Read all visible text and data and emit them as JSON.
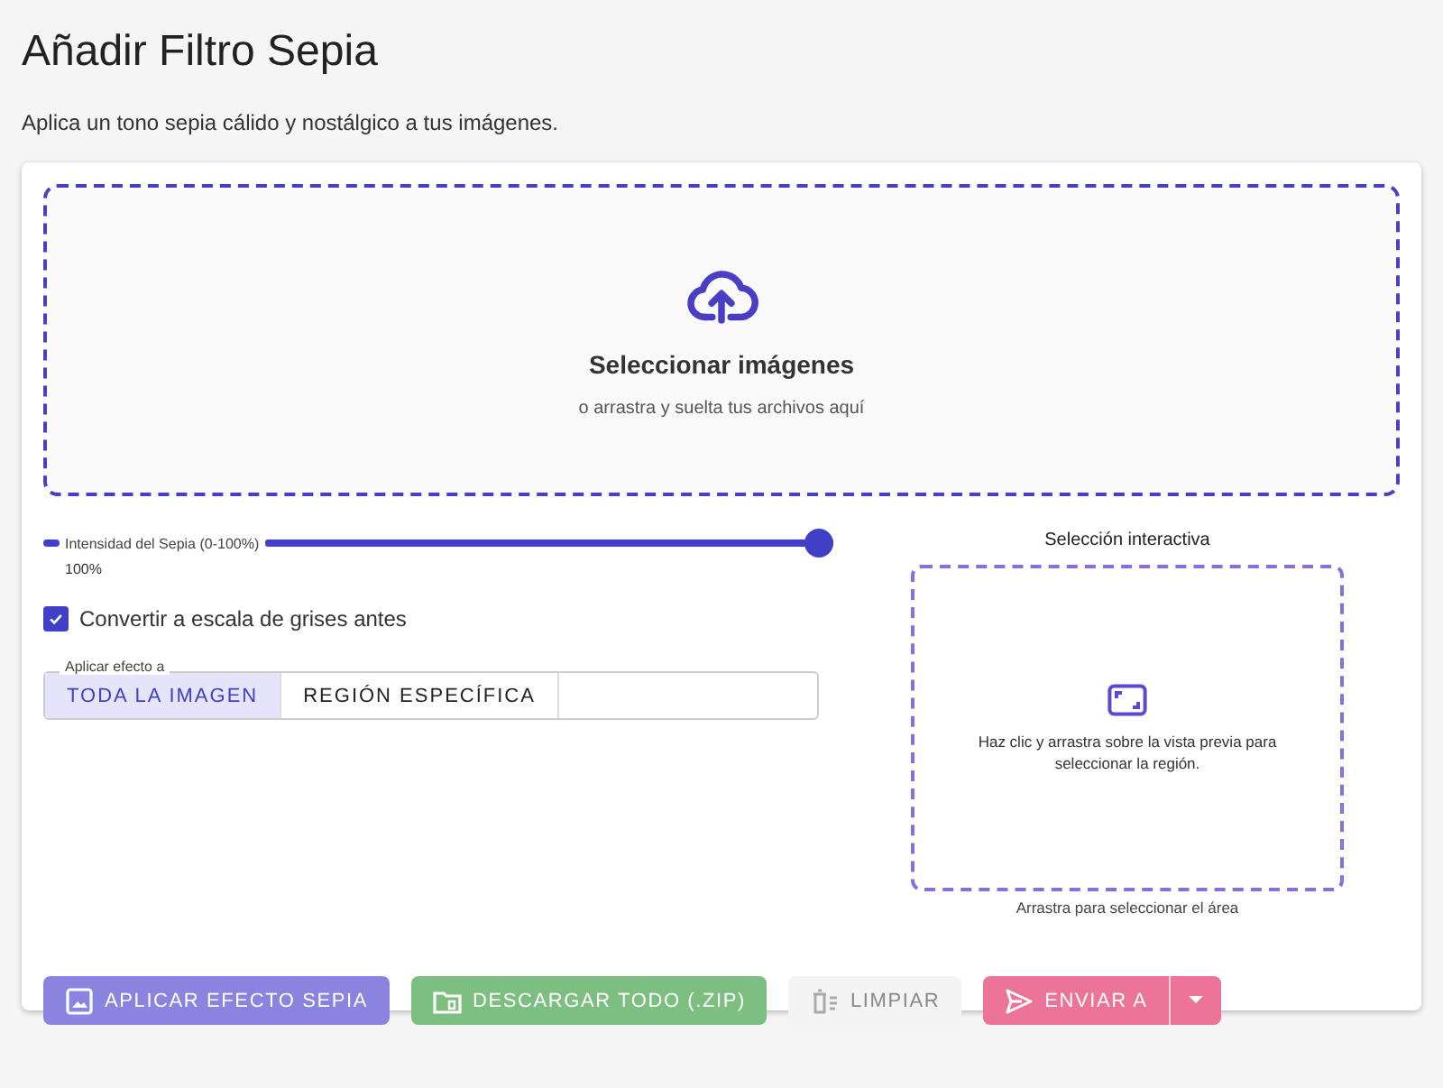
{
  "page": {
    "title": "Añadir Filtro Sepia",
    "subtitle": "Aplica un tono sepia cálido y nostálgico a tus imágenes."
  },
  "dropzone": {
    "title": "Seleccionar imágenes",
    "hint": "o arrastra y suelta tus archivos aquí"
  },
  "slider": {
    "label": "Intensidad del Sepia (0-100%)",
    "level": 1,
    "reading": "100%"
  },
  "checkbox": {
    "label": "Convertir a escala de grises antes",
    "checked": true
  },
  "apply_to": {
    "legend": "Aplicar efecto a",
    "options": [
      {
        "label": "TODA LA IMAGEN",
        "selected": true
      },
      {
        "label": "REGIÓN ESPECÍFICA",
        "selected": false
      }
    ]
  },
  "selection": {
    "title": "Selección interactiva",
    "hint": "Haz clic y arrastra sobre la vista previa para seleccionar la región.",
    "caption": "Arrastra para seleccionar el área"
  },
  "buttons": [
    {
      "kind": "apply",
      "label": "APLICAR EFECTO SEPIA",
      "disabled": true,
      "color": "#8884e0"
    },
    {
      "kind": "download",
      "label": "DESCARGAR TODO (.ZIP)",
      "disabled": true,
      "color": "#7cbf80"
    },
    {
      "kind": "clear",
      "label": "LIMPIAR",
      "disabled": true
    },
    {
      "kind": "send",
      "label": "ENVIAR A",
      "disabled": true,
      "color": "#ec7499"
    }
  ]
}
